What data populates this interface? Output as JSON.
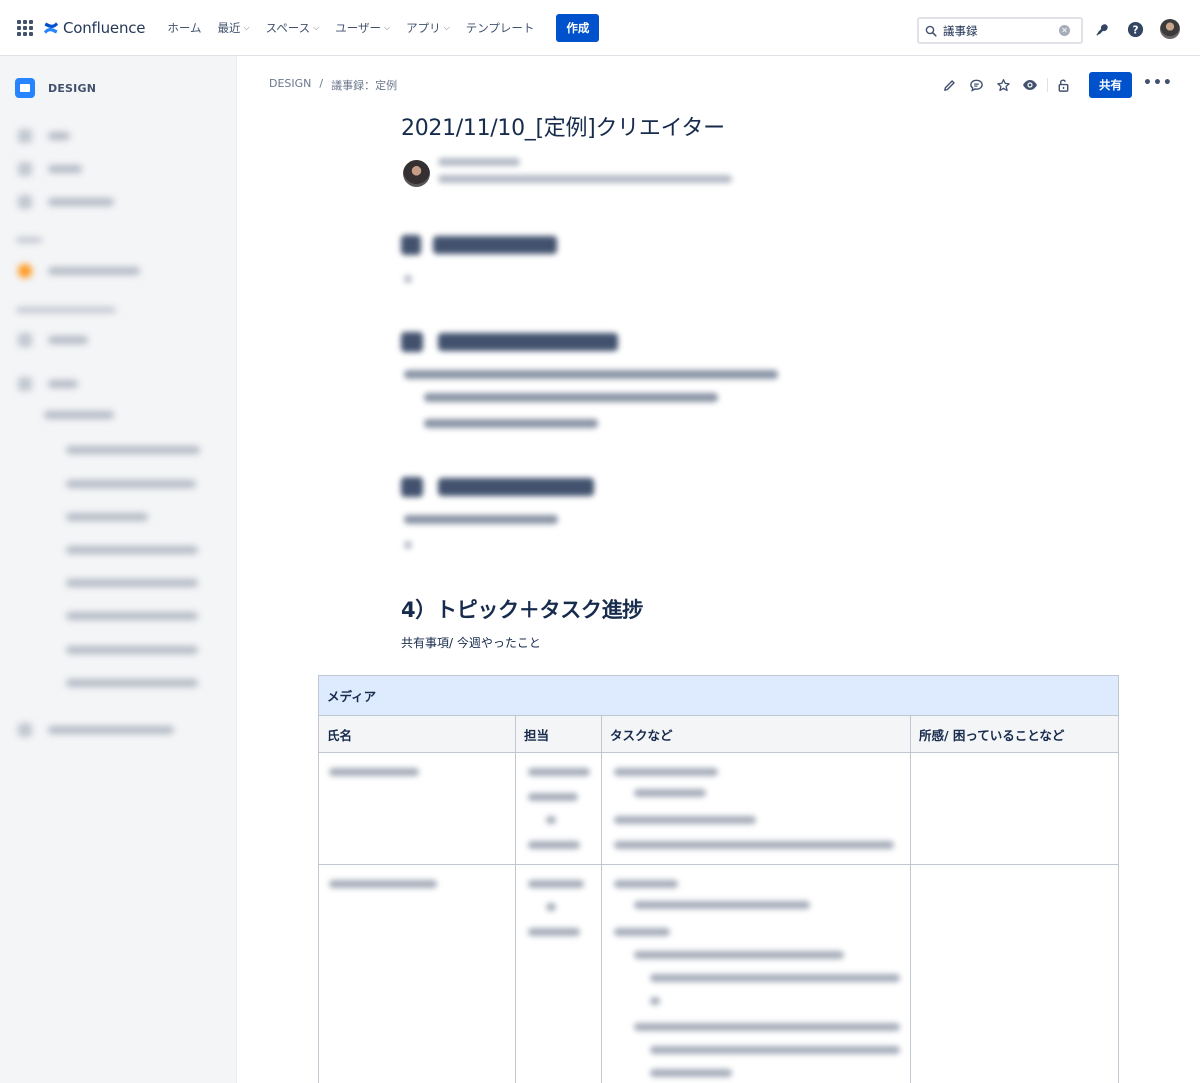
{
  "app": {
    "product_name": "Confluence",
    "nav": [
      {
        "label": "ホーム",
        "dropdown": false
      },
      {
        "label": "最近",
        "dropdown": true
      },
      {
        "label": "スペース",
        "dropdown": true
      },
      {
        "label": "ユーザー",
        "dropdown": true
      },
      {
        "label": "アプリ",
        "dropdown": true
      },
      {
        "label": "テンプレート",
        "dropdown": false
      }
    ],
    "create_label": "作成",
    "search_value": "議事録",
    "accent": "#0052cc"
  },
  "sidebar": {
    "space_name": "DESIGN"
  },
  "page": {
    "breadcrumb": [
      "DESIGN",
      "議事録：定例"
    ],
    "breadcrumb_sep": "/",
    "share_label": "共有",
    "more_label": "•••",
    "title": "2021/11/10_[定例]クリエイター",
    "section4_heading": "4）トピック＋タスク進捗",
    "section4_subtext": "共有事項/ 今週やったこと"
  },
  "table": {
    "group_label": "メディア",
    "columns": [
      "氏名",
      "担当",
      "タスクなど",
      "所感/ 困っていることなど"
    ]
  },
  "icons": {
    "app_switcher": "app-switcher-icon",
    "search": "search-icon",
    "clear": "clear-icon",
    "notifications": "notification-icon",
    "help": "help-icon",
    "edit": "edit-icon",
    "comment": "comment-icon",
    "star": "star-icon",
    "watch": "watch-icon",
    "restrictions": "unlock-icon"
  }
}
